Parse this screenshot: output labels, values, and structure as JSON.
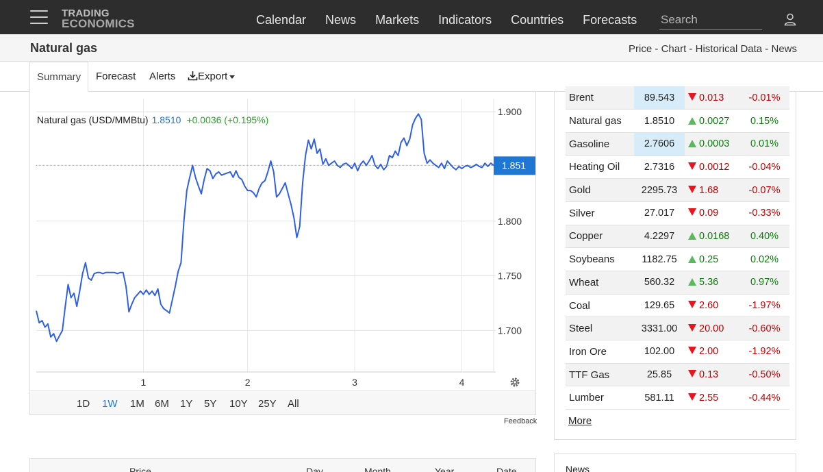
{
  "navbar": {
    "logo_line1": "TRADING",
    "logo_line2": "ECONOMICS",
    "links": [
      "Calendar",
      "News",
      "Markets",
      "Indicators",
      "Countries",
      "Forecasts"
    ],
    "search_placeholder": "Search"
  },
  "subheader": {
    "title": "Natural gas",
    "links": [
      "Price",
      "Chart",
      "Historical Data",
      "News"
    ],
    "separator": " - "
  },
  "tabs": {
    "summary": "Summary",
    "forecast": "Forecast",
    "alerts": "Alerts",
    "export": "Export"
  },
  "chart": {
    "legend_name": "Natural gas (USD/MMBtu)",
    "legend_price": "1.8510",
    "legend_change": "+0.0036 (+0.195%)",
    "current_label": "1.851",
    "range_buttons": [
      "1D",
      "1W",
      "1M",
      "6M",
      "1Y",
      "5Y",
      "10Y",
      "25Y",
      "All"
    ],
    "active_range": "1W",
    "feedback": "Feedback"
  },
  "chart_data": {
    "type": "line",
    "series": [
      {
        "values": [
          1.718,
          1.707,
          1.709,
          1.703,
          1.706,
          1.694,
          1.697,
          1.69,
          1.695,
          1.7,
          1.722,
          1.742,
          1.73,
          1.734,
          1.722,
          1.736,
          1.752,
          1.762,
          1.748,
          1.746,
          1.752,
          1.753,
          1.753,
          1.752,
          1.753,
          1.753,
          1.753,
          1.753,
          1.752,
          1.753,
          1.753,
          1.74,
          1.717,
          1.724,
          1.73,
          1.733,
          1.736,
          1.733,
          1.737,
          1.733,
          1.736,
          1.732,
          1.738,
          1.724,
          1.72,
          1.718,
          1.716,
          1.728,
          1.74,
          1.754,
          1.762,
          1.8,
          1.828,
          1.84,
          1.851,
          1.84,
          1.832,
          1.825,
          1.838,
          1.848,
          1.846,
          1.839,
          1.843,
          1.845,
          1.842,
          1.843,
          1.844,
          1.845,
          1.84,
          1.846,
          1.84,
          1.838,
          1.832,
          1.828,
          1.828,
          1.826,
          1.822,
          1.83,
          1.835,
          1.837,
          1.845,
          1.855,
          1.845,
          1.822,
          1.825,
          1.83,
          1.835,
          1.825,
          1.815,
          1.803,
          1.785,
          1.795,
          1.835,
          1.86,
          1.874,
          1.866,
          1.875,
          1.862,
          1.866,
          1.852,
          1.857,
          1.851,
          1.853,
          1.855,
          1.851,
          1.849,
          1.852,
          1.853,
          1.851,
          1.848,
          1.853,
          1.846,
          1.852,
          1.855,
          1.851,
          1.855,
          1.86,
          1.851,
          1.848,
          1.852,
          1.847,
          1.85,
          1.86,
          1.858,
          1.864,
          1.86,
          1.872,
          1.876,
          1.869,
          1.875,
          1.888,
          1.894,
          1.898,
          1.893,
          1.862,
          1.853,
          1.856,
          1.853,
          1.851,
          1.849,
          1.853,
          1.848,
          1.855,
          1.852,
          1.849,
          1.847,
          1.85,
          1.848,
          1.85,
          1.851,
          1.849,
          1.85,
          1.852,
          1.85,
          1.849,
          1.853,
          1.85,
          1.853,
          1.851
        ]
      }
    ],
    "x_ticks": [
      "1",
      "2",
      "3",
      "4"
    ],
    "y_ticks": [
      "1.700",
      "1.750",
      "1.800",
      "1.900"
    ],
    "ylim": [
      1.662,
      1.912
    ],
    "reference_line": 1.851,
    "grid": true,
    "line_color": "#2e5fe6"
  },
  "commodities": [
    {
      "name": "Brent",
      "price": "89.543",
      "change": "0.013",
      "pct": "-0.01%",
      "dir": "down",
      "highlight": true
    },
    {
      "name": "Natural gas",
      "price": "1.8510",
      "change": "0.0027",
      "pct": "0.15%",
      "dir": "up",
      "highlight": false
    },
    {
      "name": "Gasoline",
      "price": "2.7606",
      "change": "0.0003",
      "pct": "0.01%",
      "dir": "up",
      "highlight": true
    },
    {
      "name": "Heating Oil",
      "price": "2.7316",
      "change": "0.0012",
      "pct": "-0.04%",
      "dir": "down",
      "highlight": false
    },
    {
      "name": "Gold",
      "price": "2295.73",
      "change": "1.68",
      "pct": "-0.07%",
      "dir": "down",
      "highlight": false
    },
    {
      "name": "Silver",
      "price": "27.017",
      "change": "0.09",
      "pct": "-0.33%",
      "dir": "down",
      "highlight": false
    },
    {
      "name": "Copper",
      "price": "4.2297",
      "change": "0.0168",
      "pct": "0.40%",
      "dir": "up",
      "highlight": false
    },
    {
      "name": "Soybeans",
      "price": "1182.75",
      "change": "0.25",
      "pct": "0.02%",
      "dir": "up",
      "highlight": false
    },
    {
      "name": "Wheat",
      "price": "560.32",
      "change": "5.36",
      "pct": "0.97%",
      "dir": "up",
      "highlight": false
    },
    {
      "name": "Coal",
      "price": "129.65",
      "change": "2.60",
      "pct": "-1.97%",
      "dir": "down",
      "highlight": false
    },
    {
      "name": "Steel",
      "price": "3331.00",
      "change": "20.00",
      "pct": "-0.60%",
      "dir": "down",
      "highlight": false
    },
    {
      "name": "Iron Ore",
      "price": "102.00",
      "change": "2.00",
      "pct": "-1.92%",
      "dir": "down",
      "highlight": false
    },
    {
      "name": "TTF Gas",
      "price": "25.85",
      "change": "0.13",
      "pct": "-0.50%",
      "dir": "down",
      "highlight": false
    },
    {
      "name": "Lumber",
      "price": "581.11",
      "change": "2.55",
      "pct": "-0.44%",
      "dir": "down",
      "highlight": false
    }
  ],
  "commodities_more": "More",
  "bottom_table": {
    "headers": [
      "Price",
      "Day",
      "Month",
      "Year",
      "Date"
    ]
  },
  "news_panel": {
    "title": "News"
  },
  "colors": {
    "navbar_bg": "#2d2d2d",
    "accent_blue": "#1f77d4",
    "positive": "#0a7d0a",
    "negative": "#c00000"
  }
}
